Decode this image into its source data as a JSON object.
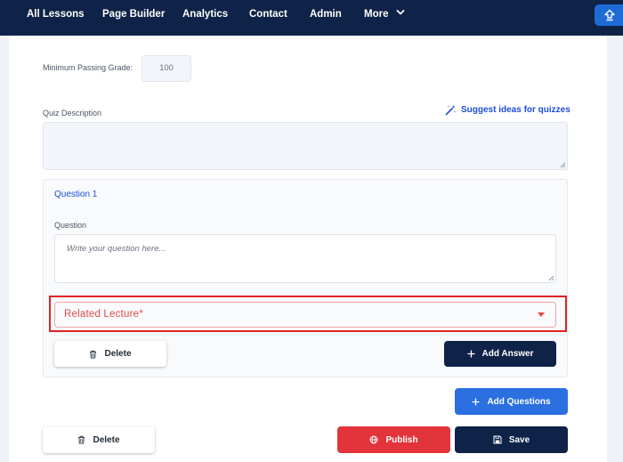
{
  "nav": {
    "items": [
      "All Lessons",
      "Page Builder",
      "Analytics",
      "Contact",
      "Admin",
      "More"
    ]
  },
  "form": {
    "min_grade_label": "Minimum Passing Grade:",
    "min_grade_value": "100",
    "quiz_description_label": "Quiz Description",
    "suggest_label": "Suggest ideas for quizzes",
    "quiz_description_value": ""
  },
  "question": {
    "title": "Question 1",
    "field_label": "Question",
    "placeholder": "Write your question here...",
    "related_lecture_label": "Related Lecture*",
    "delete_label": "Delete",
    "add_answer_label": "Add Answer"
  },
  "actions": {
    "add_questions_label": "Add Questions",
    "delete_label": "Delete",
    "publish_label": "Publish",
    "save_label": "Save"
  },
  "colors": {
    "nav_bg": "#0f2247",
    "primary_blue": "#2b6fe0",
    "link_blue": "#1d4ed8",
    "error_red": "#e02424",
    "publish_red": "#e3343b"
  },
  "icons": [
    "chevron-down-icon",
    "upload-icon",
    "magic-wand-icon",
    "trash-icon",
    "plus-icon",
    "globe-icon",
    "save-icon"
  ]
}
